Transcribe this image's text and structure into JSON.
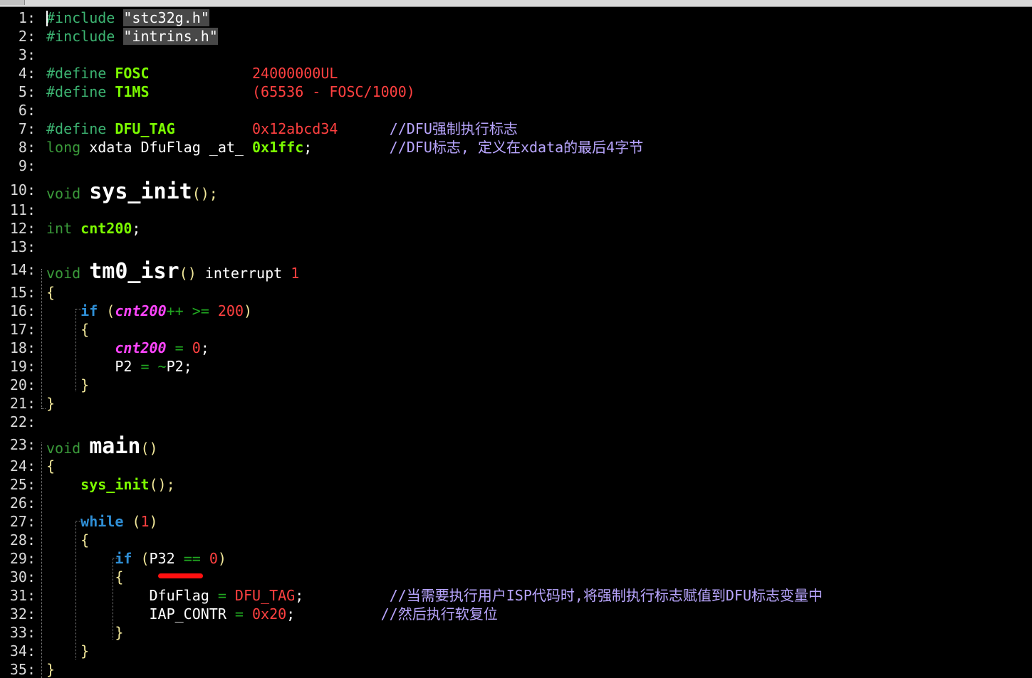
{
  "lines": [
    {
      "n": "1:",
      "tokens": [
        {
          "t": "#include",
          "c": "pp"
        },
        {
          "t": " ",
          "c": "plain"
        },
        {
          "t": "\"stc32g.h\"",
          "c": "str"
        }
      ]
    },
    {
      "n": "2:",
      "tokens": [
        {
          "t": "#include",
          "c": "pp"
        },
        {
          "t": " ",
          "c": "plain"
        },
        {
          "t": "\"intrins.h\"",
          "c": "str"
        }
      ]
    },
    {
      "n": "3:",
      "tokens": []
    },
    {
      "n": "4:",
      "tokens": [
        {
          "t": "#define",
          "c": "pp"
        },
        {
          "t": " ",
          "c": "plain"
        },
        {
          "t": "FOSC",
          "c": "macro"
        },
        {
          "t": "            ",
          "c": "plain"
        },
        {
          "t": "24000000UL",
          "c": "num"
        }
      ]
    },
    {
      "n": "5:",
      "tokens": [
        {
          "t": "#define",
          "c": "pp"
        },
        {
          "t": " ",
          "c": "plain"
        },
        {
          "t": "T1MS",
          "c": "macro"
        },
        {
          "t": "            ",
          "c": "plain"
        },
        {
          "t": "(65536 - FOSC/1000)",
          "c": "num"
        }
      ]
    },
    {
      "n": "6:",
      "tokens": []
    },
    {
      "n": "7:",
      "tokens": [
        {
          "t": "#define",
          "c": "pp"
        },
        {
          "t": " ",
          "c": "plain"
        },
        {
          "t": "DFU_TAG",
          "c": "macro"
        },
        {
          "t": "         ",
          "c": "plain"
        },
        {
          "t": "0x12abcd34",
          "c": "num"
        },
        {
          "t": "      ",
          "c": "plain"
        },
        {
          "t": "//DFU强制执行标志",
          "c": "cmt"
        }
      ]
    },
    {
      "n": "8:",
      "tokens": [
        {
          "t": "long",
          "c": "kw"
        },
        {
          "t": " xdata DfuFlag _at_ ",
          "c": "plain"
        },
        {
          "t": "0x1ffc",
          "c": "macro"
        },
        {
          "t": ";",
          "c": "plain"
        },
        {
          "t": "         ",
          "c": "plain"
        },
        {
          "t": "//DFU标志, 定义在xdata的最后4字节",
          "c": "cmt"
        }
      ]
    },
    {
      "n": "9:",
      "tokens": []
    },
    {
      "n": "10:",
      "tokens": [
        {
          "t": "void",
          "c": "kw"
        },
        {
          "t": " ",
          "c": "plain"
        },
        {
          "t": "sys_init",
          "c": "big"
        },
        {
          "t": "();",
          "c": "br"
        }
      ]
    },
    {
      "n": "11:",
      "tokens": []
    },
    {
      "n": "12:",
      "tokens": [
        {
          "t": "int",
          "c": "kw"
        },
        {
          "t": " ",
          "c": "plain"
        },
        {
          "t": "cnt200",
          "c": "fn"
        },
        {
          "t": ";",
          "c": "plain"
        }
      ]
    },
    {
      "n": "13:",
      "tokens": []
    },
    {
      "n": "14:",
      "tokens": [
        {
          "t": "void",
          "c": "kw"
        },
        {
          "t": " ",
          "c": "plain"
        },
        {
          "t": "tm0_isr",
          "c": "big"
        },
        {
          "t": "()",
          "c": "br"
        },
        {
          "t": " interrupt ",
          "c": "plain"
        },
        {
          "t": "1",
          "c": "num"
        }
      ]
    },
    {
      "n": "15:",
      "tokens": [
        {
          "t": "{",
          "c": "br"
        }
      ]
    },
    {
      "n": "16:",
      "tokens": [
        {
          "t": "    ",
          "c": "plain"
        },
        {
          "t": "if",
          "c": "ctl"
        },
        {
          "t": " (",
          "c": "br"
        },
        {
          "t": "cnt200",
          "c": "var"
        },
        {
          "t": "++ >=",
          "c": "op"
        },
        {
          "t": " ",
          "c": "plain"
        },
        {
          "t": "200",
          "c": "num"
        },
        {
          "t": ")",
          "c": "br"
        }
      ]
    },
    {
      "n": "17:",
      "tokens": [
        {
          "t": "    ",
          "c": "plain"
        },
        {
          "t": "{",
          "c": "br"
        }
      ]
    },
    {
      "n": "18:",
      "tokens": [
        {
          "t": "        ",
          "c": "plain"
        },
        {
          "t": "cnt200",
          "c": "var"
        },
        {
          "t": " = ",
          "c": "op"
        },
        {
          "t": "0",
          "c": "num"
        },
        {
          "t": ";",
          "c": "plain"
        }
      ]
    },
    {
      "n": "19:",
      "tokens": [
        {
          "t": "        P2 ",
          "c": "plain"
        },
        {
          "t": "= ~",
          "c": "op"
        },
        {
          "t": "P2;",
          "c": "plain"
        }
      ]
    },
    {
      "n": "20:",
      "tokens": [
        {
          "t": "    ",
          "c": "plain"
        },
        {
          "t": "}",
          "c": "br"
        }
      ]
    },
    {
      "n": "21:",
      "tokens": [
        {
          "t": "}",
          "c": "br"
        }
      ]
    },
    {
      "n": "22:",
      "tokens": []
    },
    {
      "n": "23:",
      "tokens": [
        {
          "t": "void",
          "c": "kw"
        },
        {
          "t": " ",
          "c": "plain"
        },
        {
          "t": "main",
          "c": "big"
        },
        {
          "t": "()",
          "c": "br"
        }
      ]
    },
    {
      "n": "24:",
      "tokens": [
        {
          "t": "{",
          "c": "br"
        }
      ]
    },
    {
      "n": "25:",
      "tokens": [
        {
          "t": "    ",
          "c": "plain"
        },
        {
          "t": "sys_init",
          "c": "fn"
        },
        {
          "t": "();",
          "c": "br"
        }
      ]
    },
    {
      "n": "26:",
      "tokens": []
    },
    {
      "n": "27:",
      "tokens": [
        {
          "t": "    ",
          "c": "plain"
        },
        {
          "t": "while",
          "c": "ctl"
        },
        {
          "t": " (",
          "c": "br"
        },
        {
          "t": "1",
          "c": "num"
        },
        {
          "t": ")",
          "c": "br"
        }
      ]
    },
    {
      "n": "28:",
      "tokens": [
        {
          "t": "    ",
          "c": "plain"
        },
        {
          "t": "{",
          "c": "br"
        }
      ]
    },
    {
      "n": "29:",
      "tokens": [
        {
          "t": "        ",
          "c": "plain"
        },
        {
          "t": "if",
          "c": "ctl"
        },
        {
          "t": " (",
          "c": "br"
        },
        {
          "t": "P32 ",
          "c": "plain"
        },
        {
          "t": "==",
          "c": "op"
        },
        {
          "t": " ",
          "c": "plain"
        },
        {
          "t": "0",
          "c": "num"
        },
        {
          "t": ")",
          "c": "br"
        }
      ]
    },
    {
      "n": "30:",
      "tokens": [
        {
          "t": "        ",
          "c": "plain"
        },
        {
          "t": "{",
          "c": "br"
        }
      ]
    },
    {
      "n": "31:",
      "tokens": [
        {
          "t": "            DfuFlag ",
          "c": "plain"
        },
        {
          "t": "=",
          "c": "op"
        },
        {
          "t": " ",
          "c": "plain"
        },
        {
          "t": "DFU_TAG",
          "c": "num"
        },
        {
          "t": ";",
          "c": "plain"
        },
        {
          "t": "          ",
          "c": "plain"
        },
        {
          "t": "//当需要执行用户ISP代码时,将强制执行标志赋值到DFU标志变量中",
          "c": "cmt"
        }
      ]
    },
    {
      "n": "32:",
      "tokens": [
        {
          "t": "            IAP_CONTR ",
          "c": "plain"
        },
        {
          "t": "=",
          "c": "op"
        },
        {
          "t": " ",
          "c": "plain"
        },
        {
          "t": "0x20",
          "c": "num"
        },
        {
          "t": ";",
          "c": "plain"
        },
        {
          "t": "          ",
          "c": "plain"
        },
        {
          "t": "//然后执行软复位",
          "c": "cmt"
        }
      ]
    },
    {
      "n": "33:",
      "tokens": [
        {
          "t": "        ",
          "c": "plain"
        },
        {
          "t": "}",
          "c": "br"
        }
      ]
    },
    {
      "n": "34:",
      "tokens": [
        {
          "t": "    ",
          "c": "plain"
        },
        {
          "t": "}",
          "c": "br"
        }
      ]
    },
    {
      "n": "35:",
      "tokens": [
        {
          "t": "}",
          "c": "br"
        }
      ]
    }
  ]
}
